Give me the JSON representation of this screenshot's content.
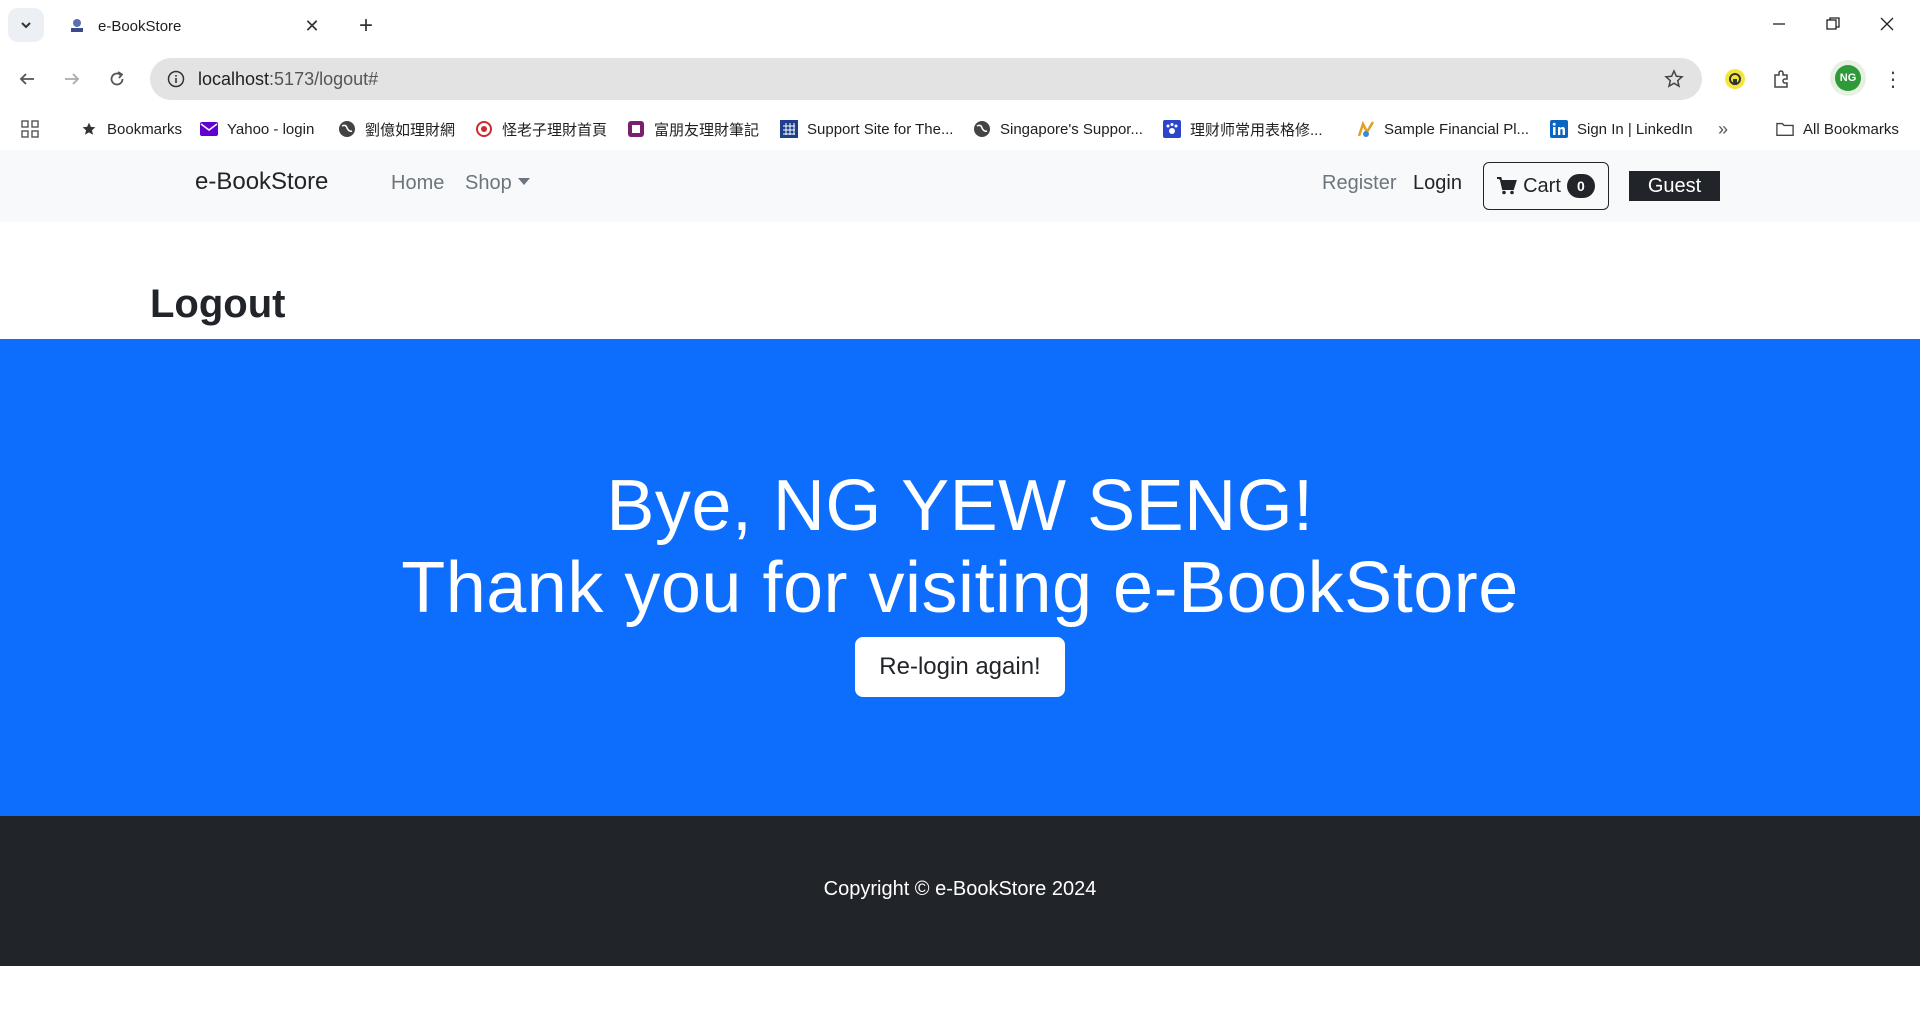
{
  "browser": {
    "tab_title": "e-BookStore",
    "url_host": "localhost",
    "url_rest": ":5173/logout#",
    "profile_initials": "NG",
    "bookmarks": [
      {
        "label": "Bookmarks",
        "icon": "star-icon"
      },
      {
        "label": "Yahoo - login",
        "icon": "yahoo-mail-icon"
      },
      {
        "label": "劉億如理財網",
        "icon": "globe-icon"
      },
      {
        "label": "怪老子理財首頁",
        "icon": "logo-icon"
      },
      {
        "label": "富朋友理財筆記",
        "icon": "logo-icon"
      },
      {
        "label": "Support Site for The...",
        "icon": "grid-logo-icon"
      },
      {
        "label": "Singapore's Suppor...",
        "icon": "globe-icon"
      },
      {
        "label": "理财师常用表格修...",
        "icon": "paw-icon"
      },
      {
        "label": "Sample Financial Pl...",
        "icon": "logo-icon"
      },
      {
        "label": "Sign In | LinkedIn",
        "icon": "linkedin-icon"
      }
    ],
    "all_bookmarks_label": "All Bookmarks"
  },
  "navbar": {
    "brand": "e-BookStore",
    "home": "Home",
    "shop": "Shop",
    "register": "Register",
    "login": "Login",
    "cart_label": "Cart",
    "cart_count": "0",
    "guest": "Guest"
  },
  "main": {
    "title": "Logout",
    "hero_line1": "Bye, NG YEW SENG!",
    "hero_line2": "Thank you for visiting e-BookStore",
    "relogin_button": "Re-login again!"
  },
  "footer": {
    "copyright": "Copyright © e-BookStore 2024"
  },
  "colors": {
    "primary": "#0d6efd",
    "dark": "#212529",
    "navbar_bg": "#f8f9fa"
  }
}
